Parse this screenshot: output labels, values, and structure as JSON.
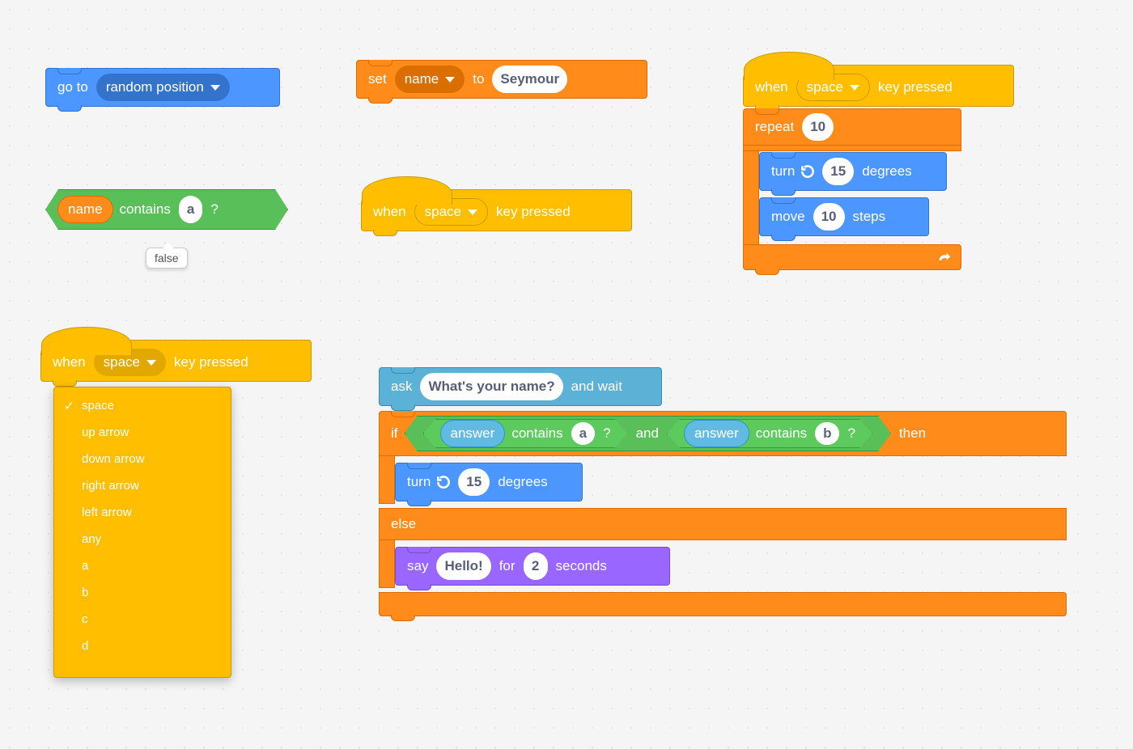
{
  "go_to": {
    "label": "go to",
    "target": "random position"
  },
  "set_var": {
    "set": "set",
    "var": "name",
    "to": "to",
    "value": "Seymour"
  },
  "contains1": {
    "var": "name",
    "contains": "contains",
    "arg": "a",
    "q": "?",
    "result": "false"
  },
  "hat_b": {
    "when": "when",
    "key": "space",
    "key_pressed": "key pressed"
  },
  "hat_c": {
    "when": "when",
    "key": "space",
    "key_pressed": "key pressed"
  },
  "hat_d": {
    "when": "when",
    "key": "space",
    "key_pressed": "key pressed"
  },
  "repeat": {
    "label": "repeat",
    "count": "10",
    "turn": {
      "label": "turn",
      "deg": "15",
      "degrees": "degrees"
    },
    "move": {
      "label": "move",
      "n": "10",
      "steps": "steps"
    }
  },
  "menu_items": [
    "space",
    "up arrow",
    "down arrow",
    "right arrow",
    "left arrow",
    "any",
    "a",
    "b",
    "c",
    "d"
  ],
  "menu_selected": "space",
  "ask": {
    "label": "ask",
    "q": "What's your name?",
    "wait": "and wait"
  },
  "ifelse": {
    "if": "if",
    "then": "then",
    "else": "else",
    "and": "and",
    "c1": {
      "rep": "answer",
      "contains": "contains",
      "arg": "a",
      "q": "?"
    },
    "c2": {
      "rep": "answer",
      "contains": "contains",
      "arg": "b",
      "q": "?"
    },
    "turn": {
      "label": "turn",
      "deg": "15",
      "degrees": "degrees"
    },
    "say": {
      "label": "say",
      "msg": "Hello!",
      "for": "for",
      "sec": "2",
      "seconds": "seconds"
    }
  }
}
